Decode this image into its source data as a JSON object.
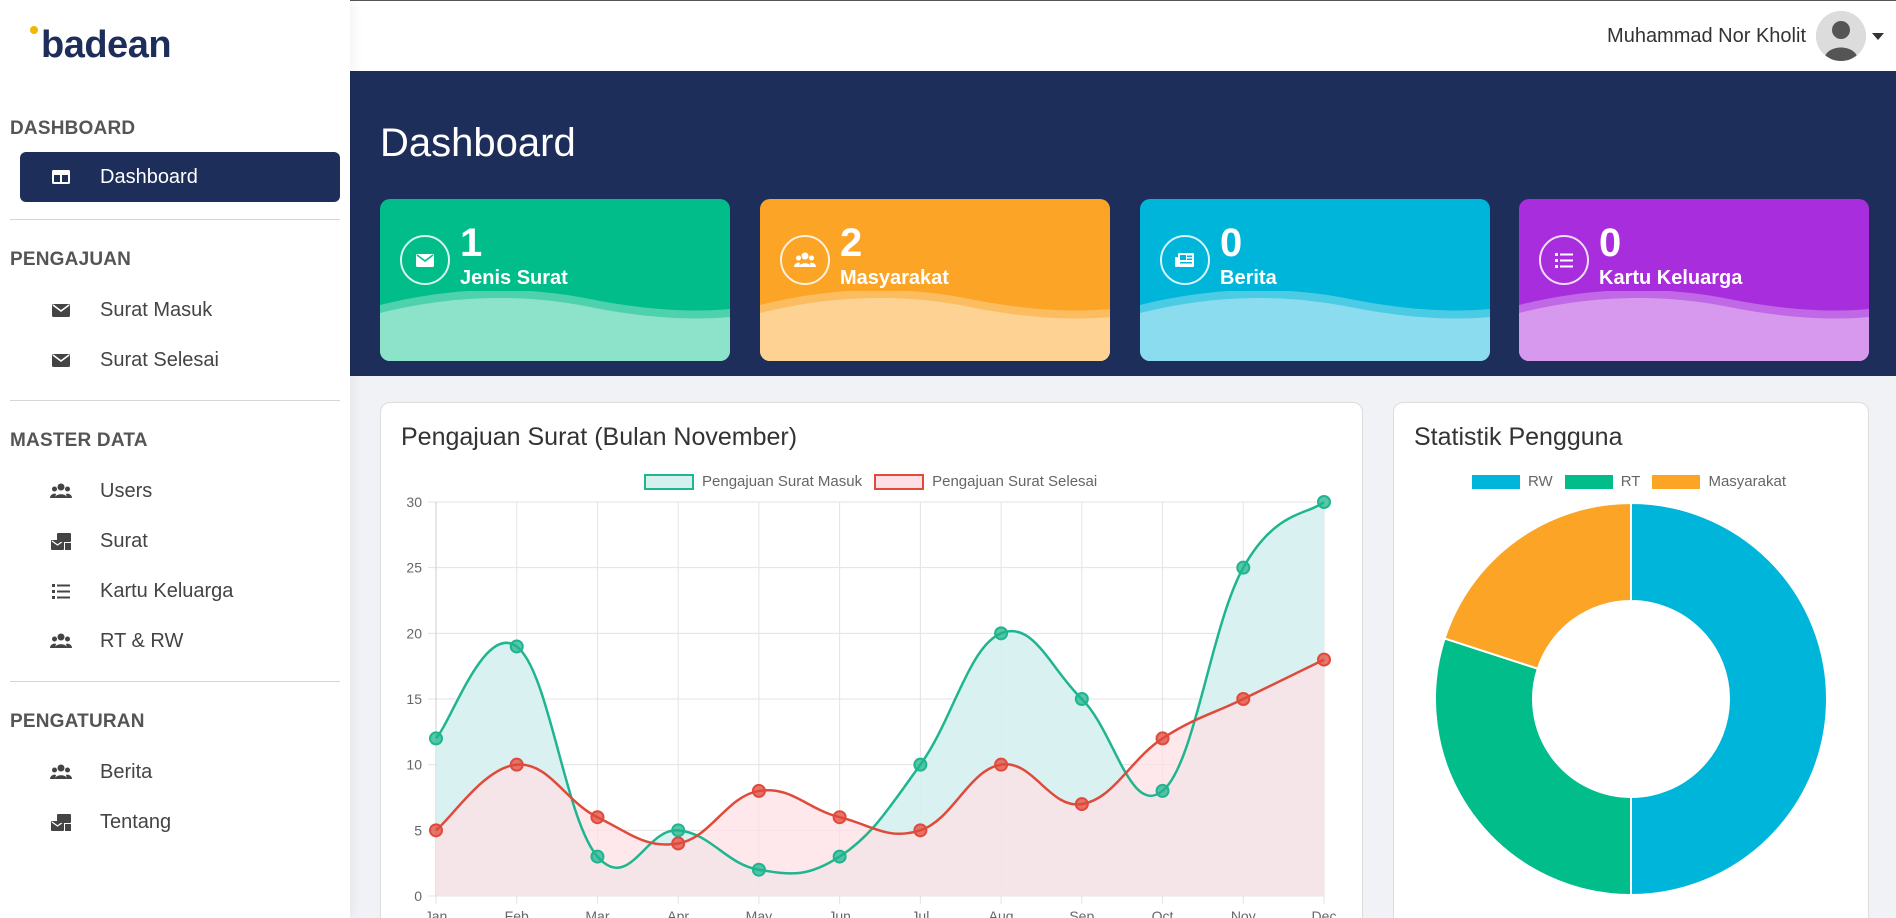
{
  "brand": {
    "logo_text": "badean"
  },
  "user": {
    "name": "Muhammad Nor Kholit"
  },
  "sidebar": {
    "sections": [
      {
        "title": "DASHBOARD",
        "items": [
          {
            "label": "Dashboard",
            "icon": "dashboard-icon",
            "active": true
          }
        ]
      },
      {
        "title": "PENGAJUAN",
        "items": [
          {
            "label": "Surat Masuk",
            "icon": "envelope-icon"
          },
          {
            "label": "Surat Selesai",
            "icon": "envelope-icon"
          }
        ]
      },
      {
        "title": "MASTER DATA",
        "items": [
          {
            "label": "Users",
            "icon": "users-icon"
          },
          {
            "label": "Surat",
            "icon": "mail-bulk-icon"
          },
          {
            "label": "Kartu Keluarga",
            "icon": "list-icon"
          },
          {
            "label": "RT & RW",
            "icon": "users-icon"
          }
        ]
      },
      {
        "title": "PENGATURAN",
        "items": [
          {
            "label": "Berita",
            "icon": "users-icon"
          },
          {
            "label": "Tentang",
            "icon": "mail-bulk-icon"
          }
        ]
      }
    ]
  },
  "page": {
    "title": "Dashboard"
  },
  "cards": [
    {
      "value": "1",
      "label": "Jenis Surat",
      "icon": "envelope-icon",
      "color": "#00bd8a",
      "wave": "#8de3ca"
    },
    {
      "value": "2",
      "label": "Masyarakat",
      "icon": "users-icon",
      "color": "#fba425",
      "wave": "#fdd292"
    },
    {
      "value": "0",
      "label": "Berita",
      "icon": "newspaper-icon",
      "color": "#00b5da",
      "wave": "#8adcee"
    },
    {
      "value": "0",
      "label": "Kartu Keluarga",
      "icon": "list-icon",
      "color": "#a82ddc",
      "wave": "#d699ee"
    }
  ],
  "panels": {
    "line_title": "Pengajuan Surat (Bulan November)",
    "donut_title": "Statistik Pengguna"
  },
  "chart_data": [
    {
      "type": "line",
      "title": "Pengajuan Surat (Bulan November)",
      "categories": [
        "Jan",
        "Feb",
        "Mar",
        "Apr",
        "May",
        "Jun",
        "Jul",
        "Aug",
        "Sep",
        "Oct",
        "Nov",
        "Dec"
      ],
      "ylim": [
        0,
        30
      ],
      "yticks": [
        0,
        5,
        10,
        15,
        20,
        25,
        30
      ],
      "grid": true,
      "legend": "top",
      "series": [
        {
          "name": "Pengajuan Surat Masuk",
          "values": [
            12,
            19,
            3,
            5,
            2,
            3,
            10,
            20,
            15,
            8,
            25,
            30
          ],
          "color": "#1fb58e",
          "fill": "#d6f0f0"
        },
        {
          "name": "Pengajuan Surat Selesai",
          "values": [
            5,
            10,
            6,
            4,
            8,
            6,
            5,
            10,
            7,
            12,
            15,
            18
          ],
          "color": "#e04a3a",
          "fill": "#fde0e6"
        }
      ]
    },
    {
      "type": "pie",
      "title": "Statistik Pengguna",
      "legend": "top",
      "categories": [
        "RW",
        "RT",
        "Masyarakat"
      ],
      "values": [
        50,
        30,
        20
      ],
      "colors": [
        "#00b5da",
        "#00bd8a",
        "#fba425"
      ]
    }
  ]
}
